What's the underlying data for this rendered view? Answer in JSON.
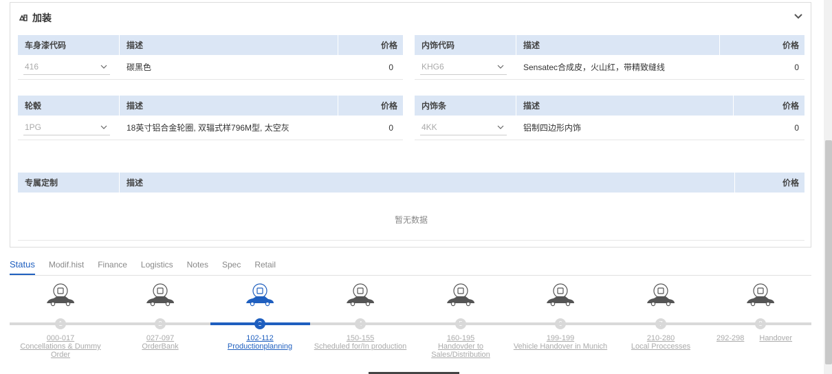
{
  "panel": {
    "title": "加装"
  },
  "paint": {
    "headers": [
      "车身漆代码",
      "描述",
      "价格"
    ],
    "code": "416",
    "desc": "碳黑色",
    "price": "0"
  },
  "trim": {
    "headers": [
      "内饰代码",
      "描述",
      "价格"
    ],
    "code": "KHG6",
    "desc": "Sensatec合成皮，火山红，带精致缝线",
    "price": "0"
  },
  "wheel": {
    "headers": [
      "轮毂",
      "描述",
      "价格"
    ],
    "code": "1PG",
    "desc": "18英寸铝合金轮圈, 双辐式样796M型, 太空灰",
    "price": "0"
  },
  "strip": {
    "headers": [
      "内饰条",
      "描述",
      "价格"
    ],
    "code": "4KK",
    "desc": "铝制四边形内饰",
    "price": "0"
  },
  "custom": {
    "headers": [
      "专属定制",
      "描述",
      "价格"
    ],
    "empty": "暂无数据"
  },
  "tabs": [
    "Status",
    "Modif.hist",
    "Finance",
    "Logistics",
    "Notes",
    "Spec",
    "Retail"
  ],
  "steps": [
    {
      "num": "1",
      "range": "000-017",
      "name": "Concellations & Dummy Order"
    },
    {
      "num": "2",
      "range": "027-097",
      "name": "OrderBank"
    },
    {
      "num": "3",
      "range": "102-112",
      "name": "Productionplanning"
    },
    {
      "num": "4",
      "range": "150-155",
      "name": "Scheduled for/In production"
    },
    {
      "num": "5",
      "range": "160-195",
      "name": "Handovder to Sales/Distribution"
    },
    {
      "num": "6",
      "range": "199-199",
      "name": "Vehicle Handover in Munich"
    },
    {
      "num": "7",
      "range": "210-280",
      "name": "Local Proccesses"
    },
    {
      "num": "8",
      "range": "292-298",
      "name": "Handover"
    }
  ],
  "active_step_index": 2,
  "colors": {
    "accent": "#1f5fbf",
    "header_bg": "#dbe6f5",
    "inactive": "#d9d9d9"
  },
  "step_icons": [
    "bank-icon",
    "bank-icon",
    "chat-check-icon",
    "question-doc-icon",
    "handshake-icon",
    "globe-icon",
    "gear-pin-icon",
    "delivery-icon"
  ]
}
